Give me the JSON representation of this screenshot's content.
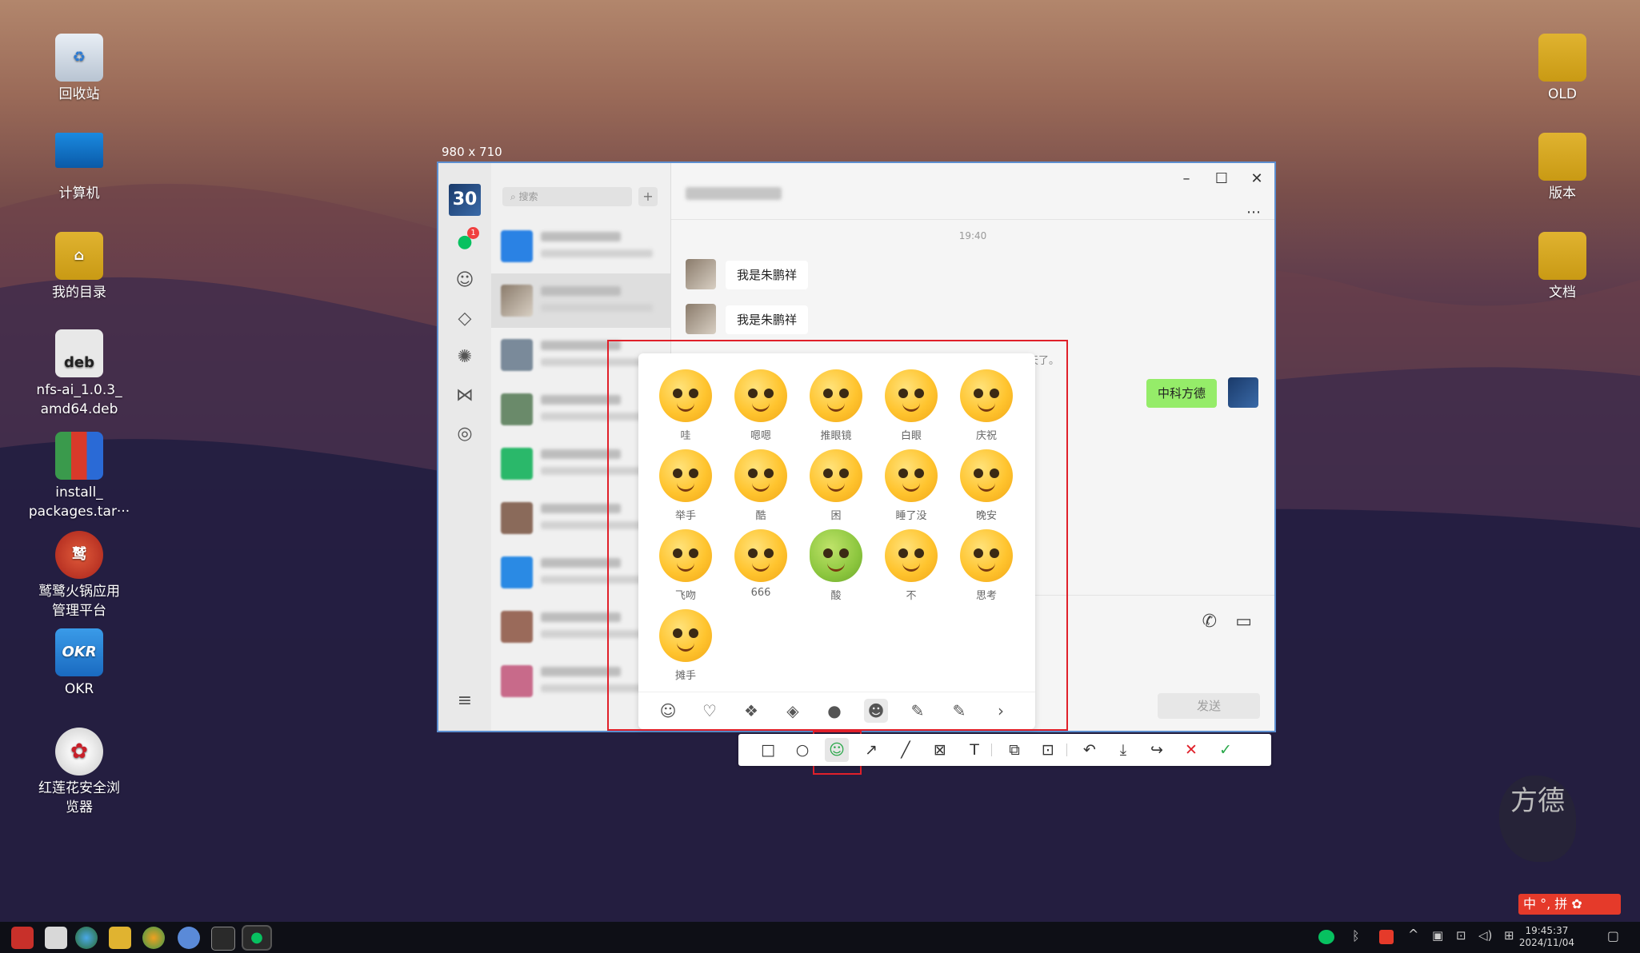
{
  "desktop": {
    "icons_left": [
      {
        "label": "回收站",
        "icon": "recycle-bin-icon"
      },
      {
        "label": "计算机",
        "icon": "computer-icon"
      },
      {
        "label": "我的目录",
        "icon": "home-folder-icon"
      },
      {
        "label": "nfs-ai_1.0.3_\namd64.deb",
        "badge": "deb",
        "icon": "deb-package-icon"
      },
      {
        "label": "install_\npackages.tar···",
        "icon": "archive-icon"
      },
      {
        "label": "鹫鹭火锅应用\n管理平台",
        "icon": "app-platform-icon"
      },
      {
        "label": "OKR",
        "badge": "OKR",
        "icon": "okr-app-icon"
      },
      {
        "label": "红莲花安全浏\n览器",
        "icon": "lotus-browser-icon"
      }
    ],
    "icons_right": [
      {
        "label": "OLD",
        "icon": "folder-icon"
      },
      {
        "label": "版本",
        "icon": "folder-icon"
      },
      {
        "label": "文档",
        "icon": "folder-icon"
      }
    ]
  },
  "selection": {
    "size_label": "980 x 710"
  },
  "app": {
    "rail_avatar": "30",
    "unread_badge": "1",
    "search_placeholder": "搜索",
    "chat": {
      "time": "19:40",
      "messages": [
        {
          "from": "other",
          "text": "我是朱鹏祥"
        },
        {
          "from": "other",
          "text": "我是朱鹏祥"
        },
        {
          "from": "me",
          "text": "中科方德"
        }
      ],
      "partial_text": "天了。",
      "send_label": "发送"
    }
  },
  "sticker_panel": {
    "stickers": [
      "哇",
      "嗯嗯",
      "推眼镜",
      "白眼",
      "庆祝",
      "举手",
      "酷",
      "困",
      "睡了没",
      "晚安",
      "飞吻",
      "666",
      "酸",
      "不",
      "思考",
      "摊手"
    ],
    "tab_icons": [
      "smiley-tab-icon",
      "heart-tab-icon",
      "sticker-pack-1-icon",
      "sticker-pack-2-icon",
      "sticker-pack-3-icon",
      "sticker-pack-4-icon",
      "sticker-pack-5-icon",
      "sticker-pack-6-icon",
      "chevron-right-icon"
    ],
    "active_tab": 5
  },
  "screenshot_toolbar": {
    "tools": [
      "rectangle-icon",
      "ellipse-icon",
      "sticker-icon",
      "arrow-icon",
      "line-icon",
      "mosaic-icon",
      "text-icon",
      "pin-icon",
      "ocr-icon",
      "undo-icon",
      "download-icon",
      "share-icon",
      "cancel-icon",
      "confirm-icon"
    ]
  },
  "taskbar": {
    "time": "19:45:37",
    "date": "2024/11/04",
    "ime_label": "中 °, 拼 ✿"
  },
  "watermark": "方德",
  "colors": {
    "highlight_red": "#e0202a",
    "wechat_green": "#95ec69",
    "confirm_green": "#2aa84a"
  }
}
